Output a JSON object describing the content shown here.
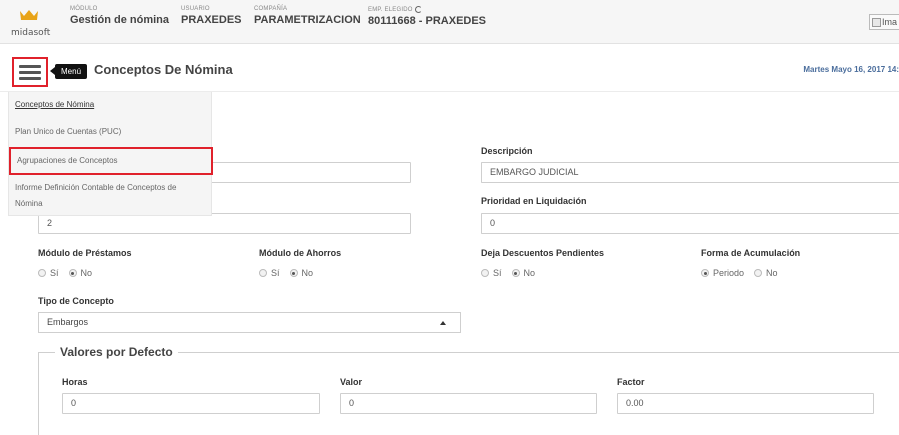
{
  "topbar": {
    "logo_text": "midasoft",
    "modulo_label": "MÓDULO",
    "modulo_value": "Gestión de nómina",
    "usuario_label": "USUARIO",
    "usuario_value": "PRAXEDES",
    "compania_label": "COMPAÑÍA",
    "compania_value": "PARAMETRIZACION",
    "emp_label": "EMP. ELEGIDO",
    "emp_value": "80111668 - PRAXEDES",
    "image_alt": "Ima"
  },
  "header": {
    "menu_tooltip": "Menú",
    "title": "Conceptos De Nómina",
    "date": "Martes Mayo 16, 2017 14:"
  },
  "menu": {
    "items": [
      "Conceptos de Nómina",
      "Plan Unico de Cuentas (PUC)",
      "Agrupaciones de Conceptos",
      "Informe Definición Contable de Conceptos de",
      "Nómina"
    ]
  },
  "form": {
    "descripcion_label": "Descripción",
    "descripcion_value": "EMBARGO JUDICIAL",
    "left_value_2": "2",
    "prioridad_label": "Prioridad en Liquidación",
    "prioridad_value": "0",
    "prestamos_label": "Módulo de Préstamos",
    "ahorros_label": "Módulo de Ahorros",
    "deja_label": "Deja Descuentos Pendientes",
    "forma_label": "Forma de Acumulación",
    "opt_si": "Sí",
    "opt_no": "No",
    "opt_periodo": "Periodo",
    "tipo_label": "Tipo de Concepto",
    "tipo_value": "Embargos",
    "defaults_legend": "Valores por Defecto",
    "horas_label": "Horas",
    "horas_value": "0",
    "valor_label": "Valor",
    "valor_value": "0",
    "factor_label": "Factor",
    "factor_value": "0.00"
  },
  "colors": {
    "highlight": "#e0212b",
    "date_text": "#4a6d9c",
    "crown": "#e8a317"
  },
  "icons": [
    "crown-logo-icon",
    "refresh-icon",
    "hamburger-menu-icon",
    "broken-image-icon",
    "caret-up-icon"
  ]
}
